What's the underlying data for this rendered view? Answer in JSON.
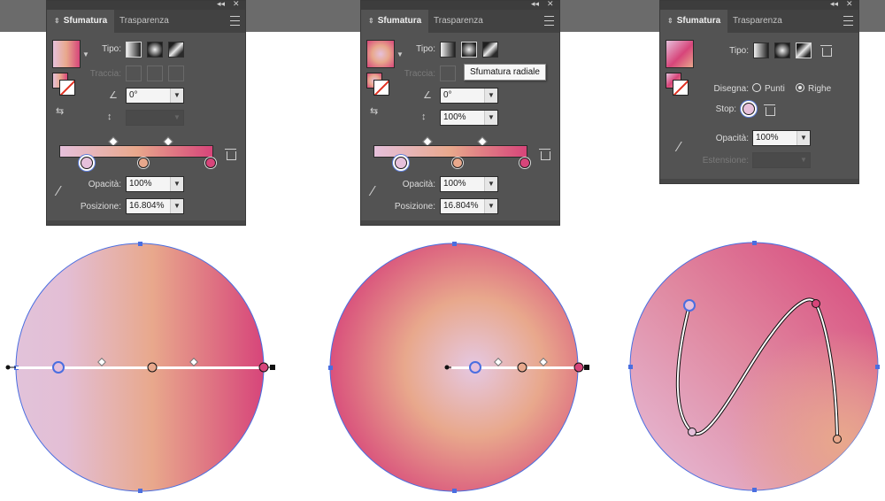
{
  "panels": [
    {
      "tab_active": "Sfumatura",
      "tab_inactive": "Trasparenza",
      "tipo_label": "Tipo:",
      "traccia_label": "Traccia:",
      "angle_value": "0°",
      "opacity_label": "Opacità:",
      "opacity_value": "100%",
      "position_label": "Posizione:",
      "position_value": "16.804%"
    },
    {
      "tab_active": "Sfumatura",
      "tab_inactive": "Trasparenza",
      "tipo_label": "Tipo:",
      "traccia_label": "Traccia:",
      "angle_value": "0°",
      "aspect_value": "100%",
      "opacity_label": "Opacità:",
      "opacity_value": "100%",
      "position_label": "Posizione:",
      "position_value": "16.804%",
      "tooltip": "Sfumatura radiale"
    },
    {
      "tab_active": "Sfumatura",
      "tab_inactive": "Trasparenza",
      "tipo_label": "Tipo:",
      "disegna_label": "Disegna:",
      "punti_label": "Punti",
      "righe_label": "Righe",
      "stop_label": "Stop:",
      "opacity_label": "Opacità:",
      "opacity_value": "100%",
      "extension_label": "Estensione:"
    }
  ],
  "colors": {
    "stop_lilac": "#e6c0db",
    "stop_peach": "#e8a88c",
    "stop_pink": "#d7457a",
    "selection_blue": "#4a6ee0"
  },
  "icons": [
    "collapse-icon",
    "close-icon",
    "panel-menu-icon",
    "angle-icon",
    "aspect-ratio-icon",
    "eyedropper-icon",
    "trash-icon",
    "reverse-gradient-icon"
  ]
}
